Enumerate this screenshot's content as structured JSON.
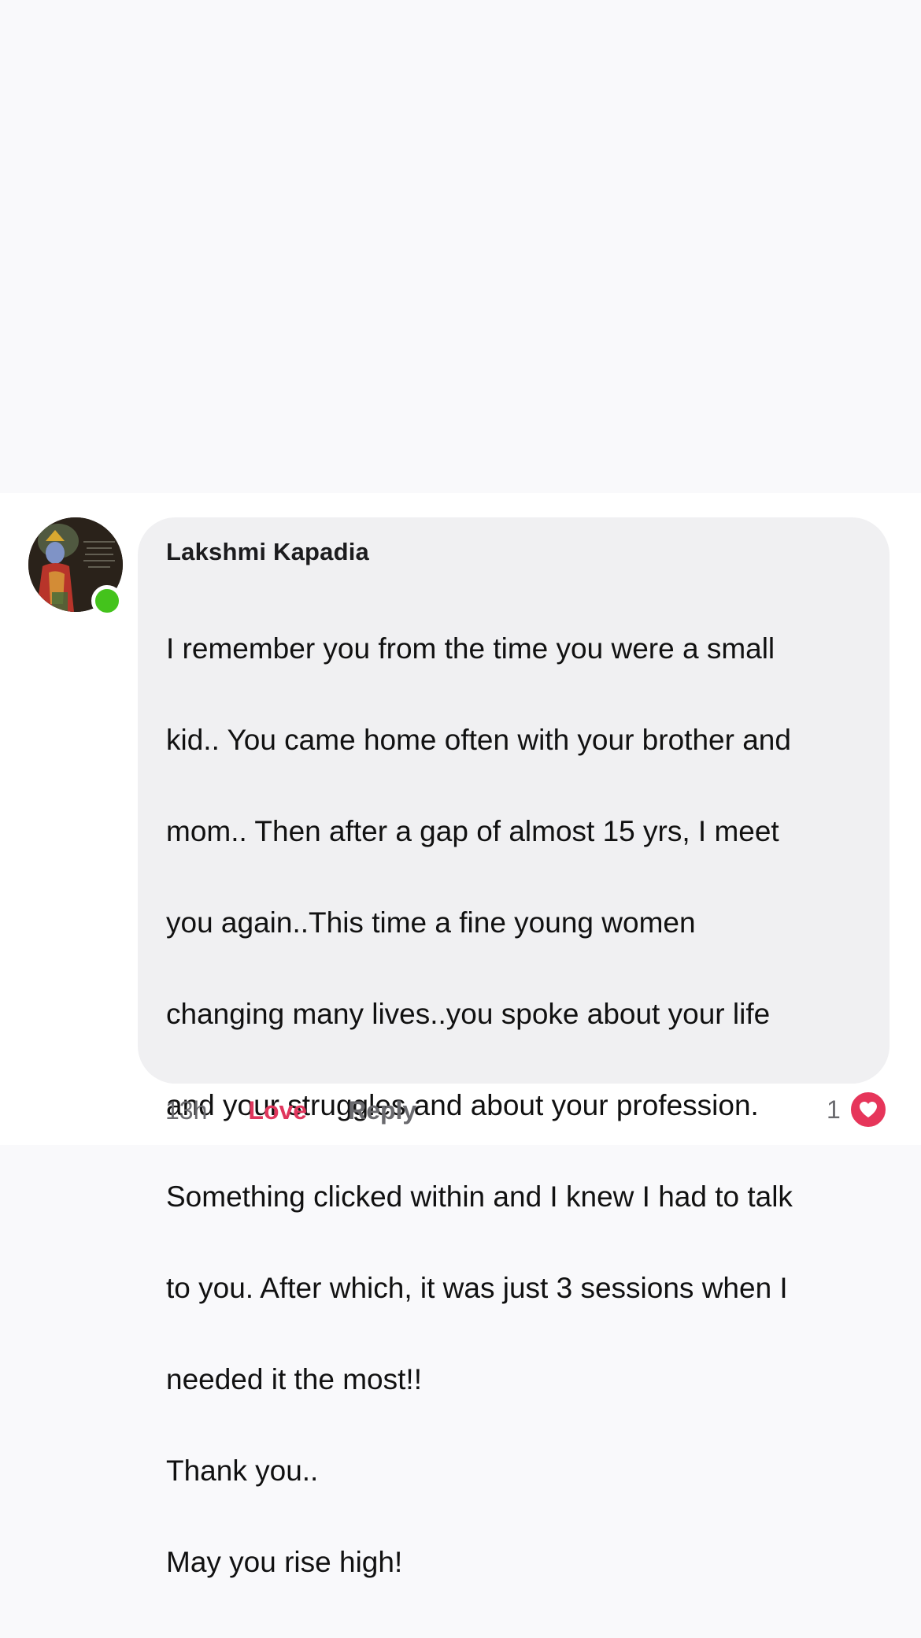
{
  "comment": {
    "author": "Lakshmi Kapadia",
    "lines": [
      "I remember you from the time you were a small",
      "kid.. You came home often with your brother and",
      "mom.. Then after a gap of almost 15 yrs, I meet",
      "you again..This time a fine young women",
      "changing many lives..you spoke about your life",
      "and your struggles and about your profession.",
      "Something clicked within and I knew I had to talk",
      "to you. After which, it was just 3 sessions when I",
      "needed it the most!!",
      "Thank you..",
      "May you rise high!"
    ],
    "time": "13h",
    "love_label": "Love",
    "reply_label": "Reply",
    "reaction_count": "1",
    "reaction_icon": "heart-icon",
    "online": true
  },
  "colors": {
    "page_background": "#f9f9fb",
    "bubble_background": "#f0f0f2",
    "love_accent": "#e0375d",
    "online_green": "#44c31c",
    "muted_text": "#6a6a6e"
  }
}
